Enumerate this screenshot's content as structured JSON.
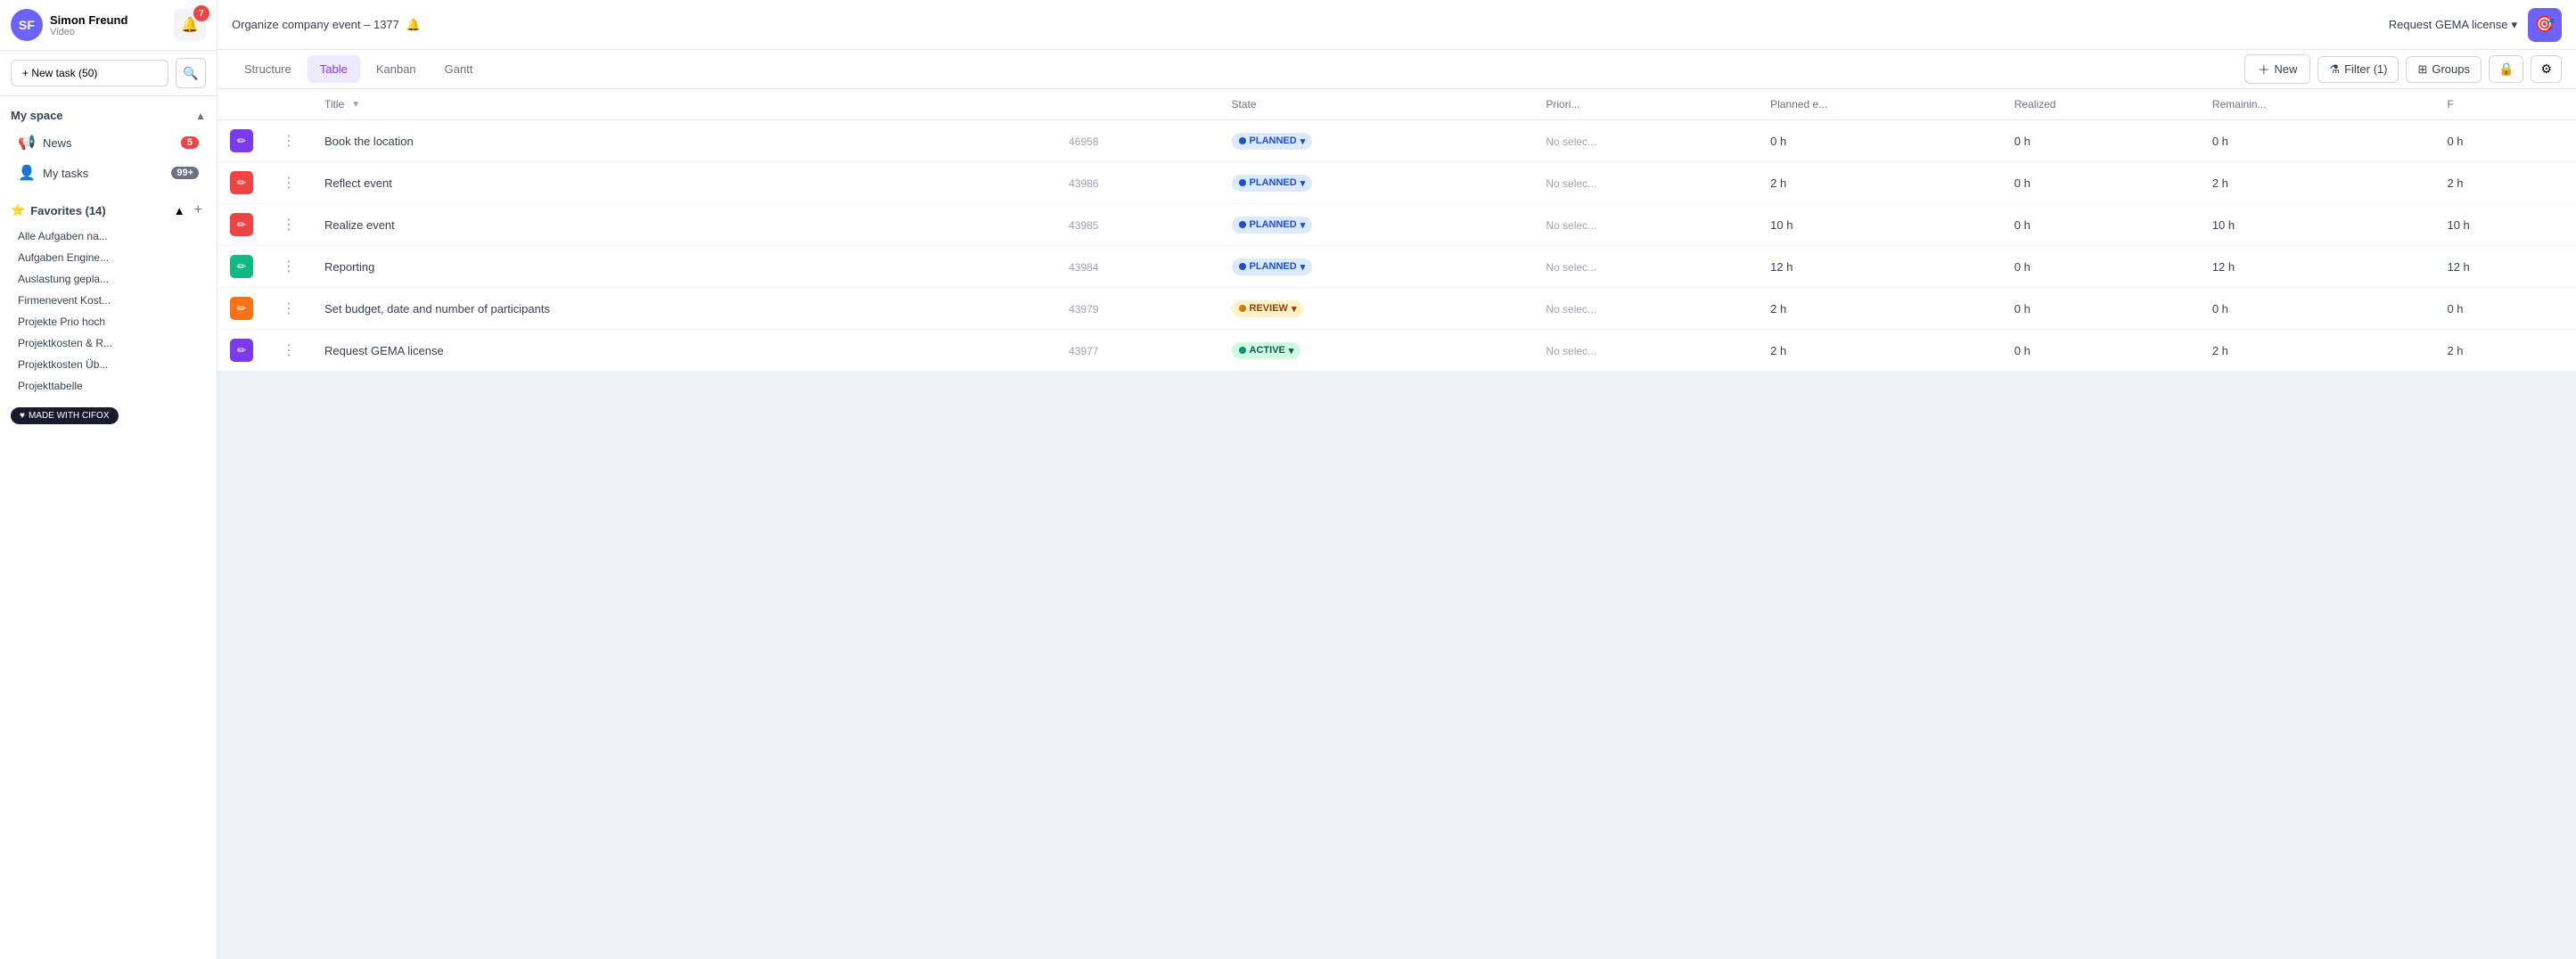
{
  "sidebar": {
    "user": {
      "name": "Simon Freund",
      "role": "Video",
      "initials": "SF"
    },
    "notification_badge": "7",
    "new_task_label": "+ New task (50)",
    "my_space_label": "My space",
    "news_label": "News",
    "news_badge": "5",
    "my_tasks_label": "My tasks",
    "my_tasks_badge": "99+",
    "favorites_label": "Favorites (14)",
    "favorites_add_label": "+",
    "favorites_items": [
      "Alle Aufgaben na...",
      "Aufgaben Engine...",
      "Auslastung gepla...",
      "Firmenevent Kost...",
      "Projekte Prio hoch",
      "Projektkosten & R...",
      "Projektkosten Üb...",
      "Projekttabelle"
    ]
  },
  "topbar": {
    "project_title": "Organize company event – 1377",
    "request_gema": "Request GEMA license",
    "request_gema_chevron": "▾"
  },
  "tabs": {
    "items": [
      "Structure",
      "Table",
      "Kanban",
      "Gantt"
    ],
    "active": "Table"
  },
  "toolbar": {
    "new_label": "New",
    "filter_label": "Filter (1)",
    "groups_label": "Groups"
  },
  "table": {
    "columns": [
      "",
      "",
      "Title",
      "",
      "State",
      "Priori...",
      "Planned e...",
      "Realized",
      "Remainin...",
      "F"
    ],
    "rows": [
      {
        "icon_color": "purple",
        "icon": "✏",
        "title": "Book the location",
        "id": "46958",
        "state": "PLANNED",
        "state_type": "planned",
        "priority": "No selec...",
        "planned_e": "0 h",
        "realized": "0 h",
        "remaining": "0 h",
        "f": "0 h"
      },
      {
        "icon_color": "red",
        "icon": "✏",
        "title": "Reflect event",
        "id": "43986",
        "state": "PLANNED",
        "state_type": "planned",
        "priority": "No selec...",
        "planned_e": "2 h",
        "realized": "0 h",
        "remaining": "2 h",
        "f": "2 h"
      },
      {
        "icon_color": "red",
        "icon": "✏",
        "title": "Realize event",
        "id": "43985",
        "state": "PLANNED",
        "state_type": "planned",
        "priority": "No selec...",
        "planned_e": "10 h",
        "realized": "0 h",
        "remaining": "10 h",
        "f": "10 h"
      },
      {
        "icon_color": "green",
        "icon": "✏",
        "title": "Reporting",
        "id": "43984",
        "state": "PLANNED",
        "state_type": "planned",
        "priority": "No selec...",
        "planned_e": "12 h",
        "realized": "0 h",
        "remaining": "12 h",
        "f": "12 h"
      },
      {
        "icon_color": "orange",
        "icon": "✏",
        "title": "Set budget, date and number of participants",
        "id": "43979",
        "state": "REVIEW",
        "state_type": "review",
        "priority": "No selec...",
        "planned_e": "2 h",
        "realized": "0 h",
        "remaining": "0 h",
        "f": "0 h"
      },
      {
        "icon_color": "purple",
        "icon": "✏",
        "title": "Request GEMA license",
        "id": "43977",
        "state": "ACTIVE",
        "state_type": "active",
        "priority": "No selec...",
        "planned_e": "2 h",
        "realized": "0 h",
        "remaining": "2 h",
        "f": "2 h"
      }
    ]
  },
  "cifox_badge": "MADE WITH CIFOX"
}
